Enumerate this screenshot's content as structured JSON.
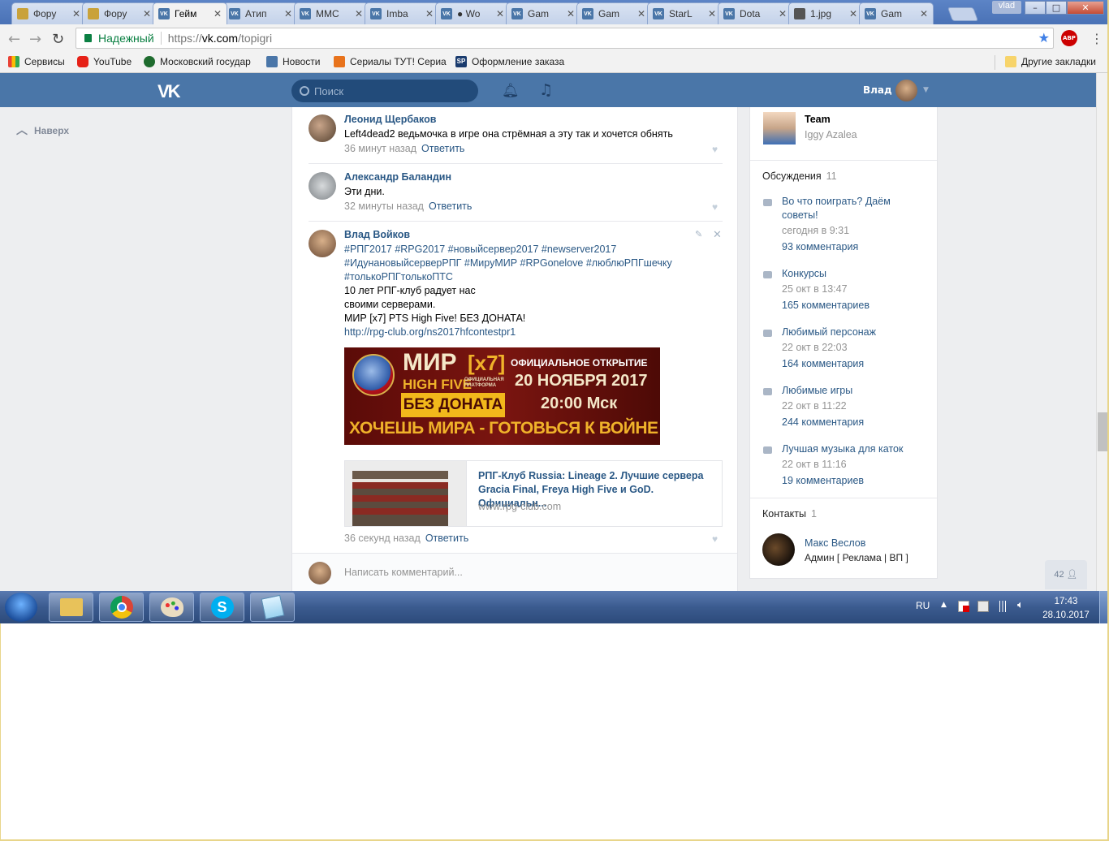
{
  "browser": {
    "tabs": [
      {
        "label": "Фору",
        "icon": "emblem"
      },
      {
        "label": "Фору",
        "icon": "emblem"
      },
      {
        "label": "Гейм",
        "icon": "vk",
        "active": true
      },
      {
        "label": "Атип",
        "icon": "vk"
      },
      {
        "label": "ММС",
        "icon": "vk"
      },
      {
        "label": "Imba",
        "icon": "vk"
      },
      {
        "label": "● Wo",
        "icon": "vk"
      },
      {
        "label": "Gam",
        "icon": "vk"
      },
      {
        "label": "Gam",
        "icon": "vk"
      },
      {
        "label": "StarL",
        "icon": "vk"
      },
      {
        "label": "Dota",
        "icon": "vk"
      },
      {
        "label": "1.jpg",
        "icon": "image"
      },
      {
        "label": "Gam",
        "icon": "vk"
      }
    ],
    "window_user": "vlad",
    "secure_label": "Надежный",
    "url_scheme": "https://",
    "url_host": "vk.com",
    "url_path": "/topigri",
    "bookmarks": [
      {
        "label": "Сервисы",
        "color": "#e94235"
      },
      {
        "label": "YouTube",
        "color": "#e62117"
      },
      {
        "label": "Московский государ",
        "color": "#1e6b2e"
      },
      {
        "label": "Новости",
        "color": "#4a76a8"
      },
      {
        "label": "Сериалы ТУТ! Сериа",
        "color": "#e8731c"
      },
      {
        "label": "Оформление заказа",
        "color": "#1a3b6e"
      }
    ],
    "other_bookmarks": "Другие закладки"
  },
  "vk": {
    "search_placeholder": "Поиск",
    "user_name": "Влад",
    "back_to_top": "Наверх",
    "comments": [
      {
        "author": "Леонид Щербаков",
        "text": "Left4dead2 ведьмочка в игре она стрёмная а эту так и хочется обнять",
        "time": "36 минут назад",
        "reply": "Ответить"
      },
      {
        "author": "Александр Баландин",
        "text": "Эти дни.",
        "time": "32 минуты назад",
        "reply": "Ответить"
      },
      {
        "author": "Влад Войков",
        "hashtags_line1": "#РПГ2017 #RPG2017 #новыйсервер2017 #newserver2017",
        "hashtags_line2": "#ИдунановыйсерверРПГ #МируМИР #RPGonelove #люблюРПГшечку",
        "hashtags_line3": "#толькоРПГтолькоПТС",
        "text_line1": "10 лет РПГ-клуб радует нас",
        "text_line2": "своими серверами.",
        "text_line3": "МИР [x7] PTS High Five! БЕЗ ДОНАТА!",
        "link": "http://rpg-club.org/ns2017hfcontestpr1",
        "banner": {
          "mir": "МИР",
          "x7": "[x7]",
          "high_five": "HIGH FIVE",
          "platform": "ОФИЦИАЛЬНАЯ ПЛАТФОРМА",
          "no_donate": "БЕЗ ДОНАТА",
          "official_open": "ОФИЦИАЛЬНОЕ ОТКРЫТИЕ",
          "date": "20 НОЯБРЯ 2017",
          "time": "20:00 Мск",
          "slogan": "ХОЧЕШЬ МИРА - ГОТОВЬСЯ К ВОЙНЕ"
        },
        "card_title": "РПГ-Клуб Russia: Lineage 2. Лучшие сервера Gracia Final, Freya High Five и GoD. Официальн...",
        "card_domain": "www.rpg-club.com",
        "time": "36 секунд назад",
        "reply": "Ответить"
      }
    ],
    "comment_placeholder": "Написать комментарий...",
    "sidebar": {
      "team_name": "Team",
      "team_sub": "Iggy Azalea",
      "discussions_label": "Обсуждения",
      "discussions_count": "11",
      "discussions": [
        {
          "title": "Во что поиграть? Даём советы!",
          "date": "сегодня в 9:31",
          "count": "93 комментария"
        },
        {
          "title": "Конкурсы",
          "date": "25 окт в 13:47",
          "count": "165 комментариев"
        },
        {
          "title": "Любимый персонаж",
          "date": "22 окт в 22:03",
          "count": "164 комментария"
        },
        {
          "title": "Любимые игры",
          "date": "22 окт в 11:22",
          "count": "244 комментария"
        },
        {
          "title": "Лучшая музыка для каток",
          "date": "22 окт в 11:16",
          "count": "19 комментариев"
        }
      ],
      "contacts_label": "Контакты",
      "contacts_count": "1",
      "contact_name": "Макс Веслов",
      "contact_role": "Админ [ Реклама | ВП ]"
    },
    "online_count": "42"
  },
  "taskbar": {
    "lang": "RU",
    "time": "17:43",
    "date": "28.10.2017"
  }
}
